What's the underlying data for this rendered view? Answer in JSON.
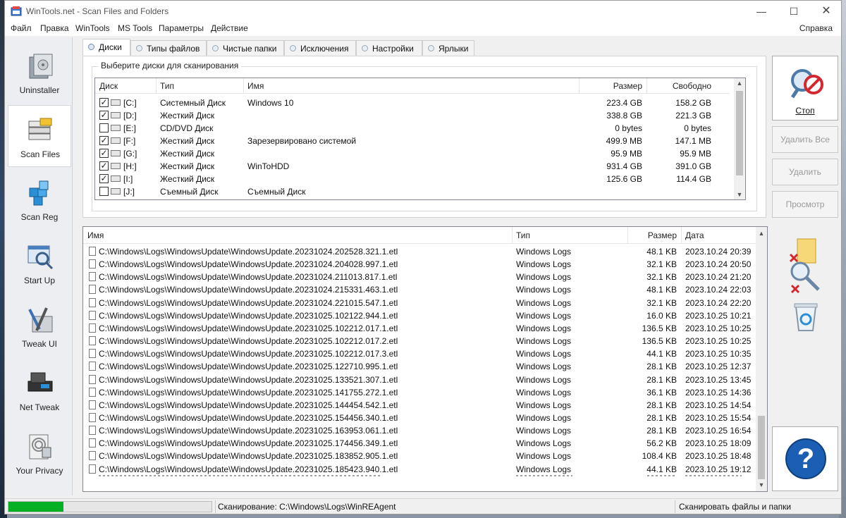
{
  "window": {
    "title": "WinTools.net - Scan Files and Folders",
    "min": "—",
    "max": "☐",
    "close": "✕"
  },
  "menu": {
    "items": [
      "Файл",
      "Правка",
      "WinTools",
      "MS Tools",
      "Параметры",
      "Действие"
    ],
    "help": "Справка"
  },
  "nav": [
    {
      "label": "Uninstaller",
      "icon": "uninstaller-icon",
      "active": false
    },
    {
      "label": "Scan Files",
      "icon": "scan-files-icon",
      "active": true
    },
    {
      "label": "Scan Reg",
      "icon": "scan-reg-icon",
      "active": false
    },
    {
      "label": "Start Up",
      "icon": "start-up-icon",
      "active": false
    },
    {
      "label": "Tweak UI",
      "icon": "tweak-ui-icon",
      "active": false
    },
    {
      "label": "Net Tweak",
      "icon": "net-tweak-icon",
      "active": false
    },
    {
      "label": "Your Privacy",
      "icon": "your-privacy-icon",
      "active": false
    }
  ],
  "tabs": [
    "Диски",
    "Типы файлов",
    "Чистые папки",
    "Исключения",
    "Настройки",
    "Ярлыки"
  ],
  "active_tab": 0,
  "disks": {
    "group_title": "Выберите диски для сканирования",
    "columns": {
      "drive": "Диск",
      "type": "Тип",
      "name": "Имя",
      "size": "Размер",
      "free": "Свободно"
    },
    "rows": [
      {
        "checked": true,
        "drive": "[C:]",
        "type": "Системный Диск",
        "name": "Windows 10",
        "size": "223.4 GB",
        "free": "158.2 GB"
      },
      {
        "checked": true,
        "drive": "[D:]",
        "type": "Жесткий Диск",
        "name": "",
        "size": "338.8 GB",
        "free": "221.3 GB"
      },
      {
        "checked": false,
        "drive": "[E:]",
        "type": "CD/DVD Диск",
        "name": "",
        "size": "0 bytes",
        "free": "0 bytes"
      },
      {
        "checked": true,
        "drive": "[F:]",
        "type": "Жесткий Диск",
        "name": "Зарезервировано системой",
        "size": "499.9 MB",
        "free": "147.1 MB"
      },
      {
        "checked": true,
        "drive": "[G:]",
        "type": "Жесткий Диск",
        "name": "",
        "size": "95.9 MB",
        "free": "95.9 MB"
      },
      {
        "checked": true,
        "drive": "[H:]",
        "type": "Жесткий Диск",
        "name": "WinToHDD",
        "size": "931.4 GB",
        "free": "391.0 GB"
      },
      {
        "checked": true,
        "drive": "[I:]",
        "type": "Жесткий Диск",
        "name": "",
        "size": "125.6 GB",
        "free": "114.4 GB"
      },
      {
        "checked": false,
        "drive": "[J:]",
        "type": "Съемный Диск",
        "name": "Съемный Диск",
        "size": "",
        "free": ""
      }
    ]
  },
  "files": {
    "columns": {
      "name": "Имя",
      "type": "Тип",
      "size": "Размер",
      "date": "Дата"
    },
    "rows": [
      {
        "name": "C:\\Windows\\Logs\\WindowsUpdate\\WindowsUpdate.20231024.202528.321.1.etl",
        "type": "Windows Logs",
        "size": "48.1 KB",
        "date": "2023.10.24 20:39"
      },
      {
        "name": "C:\\Windows\\Logs\\WindowsUpdate\\WindowsUpdate.20231024.204028.997.1.etl",
        "type": "Windows Logs",
        "size": "32.1 KB",
        "date": "2023.10.24 20:50"
      },
      {
        "name": "C:\\Windows\\Logs\\WindowsUpdate\\WindowsUpdate.20231024.211013.817.1.etl",
        "type": "Windows Logs",
        "size": "32.1 KB",
        "date": "2023.10.24 21:20"
      },
      {
        "name": "C:\\Windows\\Logs\\WindowsUpdate\\WindowsUpdate.20231024.215331.463.1.etl",
        "type": "Windows Logs",
        "size": "48.1 KB",
        "date": "2023.10.24 22:03"
      },
      {
        "name": "C:\\Windows\\Logs\\WindowsUpdate\\WindowsUpdate.20231024.221015.547.1.etl",
        "type": "Windows Logs",
        "size": "32.1 KB",
        "date": "2023.10.24 22:20"
      },
      {
        "name": "C:\\Windows\\Logs\\WindowsUpdate\\WindowsUpdate.20231025.102122.944.1.etl",
        "type": "Windows Logs",
        "size": "16.0 KB",
        "date": "2023.10.25 10:21"
      },
      {
        "name": "C:\\Windows\\Logs\\WindowsUpdate\\WindowsUpdate.20231025.102212.017.1.etl",
        "type": "Windows Logs",
        "size": "136.5 KB",
        "date": "2023.10.25 10:25"
      },
      {
        "name": "C:\\Windows\\Logs\\WindowsUpdate\\WindowsUpdate.20231025.102212.017.2.etl",
        "type": "Windows Logs",
        "size": "136.5 KB",
        "date": "2023.10.25 10:25"
      },
      {
        "name": "C:\\Windows\\Logs\\WindowsUpdate\\WindowsUpdate.20231025.102212.017.3.etl",
        "type": "Windows Logs",
        "size": "44.1 KB",
        "date": "2023.10.25 10:35"
      },
      {
        "name": "C:\\Windows\\Logs\\WindowsUpdate\\WindowsUpdate.20231025.122710.995.1.etl",
        "type": "Windows Logs",
        "size": "28.1 KB",
        "date": "2023.10.25 12:37"
      },
      {
        "name": "C:\\Windows\\Logs\\WindowsUpdate\\WindowsUpdate.20231025.133521.307.1.etl",
        "type": "Windows Logs",
        "size": "28.1 KB",
        "date": "2023.10.25 13:45"
      },
      {
        "name": "C:\\Windows\\Logs\\WindowsUpdate\\WindowsUpdate.20231025.141755.272.1.etl",
        "type": "Windows Logs",
        "size": "36.1 KB",
        "date": "2023.10.25 14:36"
      },
      {
        "name": "C:\\Windows\\Logs\\WindowsUpdate\\WindowsUpdate.20231025.144454.542.1.etl",
        "type": "Windows Logs",
        "size": "28.1 KB",
        "date": "2023.10.25 14:54"
      },
      {
        "name": "C:\\Windows\\Logs\\WindowsUpdate\\WindowsUpdate.20231025.154456.340.1.etl",
        "type": "Windows Logs",
        "size": "28.1 KB",
        "date": "2023.10.25 15:54"
      },
      {
        "name": "C:\\Windows\\Logs\\WindowsUpdate\\WindowsUpdate.20231025.163953.061.1.etl",
        "type": "Windows Logs",
        "size": "28.1 KB",
        "date": "2023.10.25 16:54"
      },
      {
        "name": "C:\\Windows\\Logs\\WindowsUpdate\\WindowsUpdate.20231025.174456.349.1.etl",
        "type": "Windows Logs",
        "size": "56.2 KB",
        "date": "2023.10.25 18:09"
      },
      {
        "name": "C:\\Windows\\Logs\\WindowsUpdate\\WindowsUpdate.20231025.183852.905.1.etl",
        "type": "Windows Logs",
        "size": "108.4 KB",
        "date": "2023.10.25 18:48"
      },
      {
        "name": "C:\\Windows\\Logs\\WindowsUpdate\\WindowsUpdate.20231025.185423.940.1.etl",
        "type": "Windows Logs",
        "size": "44.1 KB",
        "date": "2023.10.25 19:12"
      }
    ]
  },
  "actions": {
    "stop": "Стоп",
    "delete_all": "Удалить Все",
    "delete": "Удалить",
    "view": "Просмотр",
    "help_glyph": "?"
  },
  "status": {
    "progress": 0.27,
    "text": "Сканирование: C:\\Windows\\Logs\\WinREAgent",
    "right": "Сканировать файлы и папки"
  },
  "colors": {
    "accent": "#1a5fb4",
    "progress": "#06b025",
    "stop_red": "#d3282f"
  }
}
